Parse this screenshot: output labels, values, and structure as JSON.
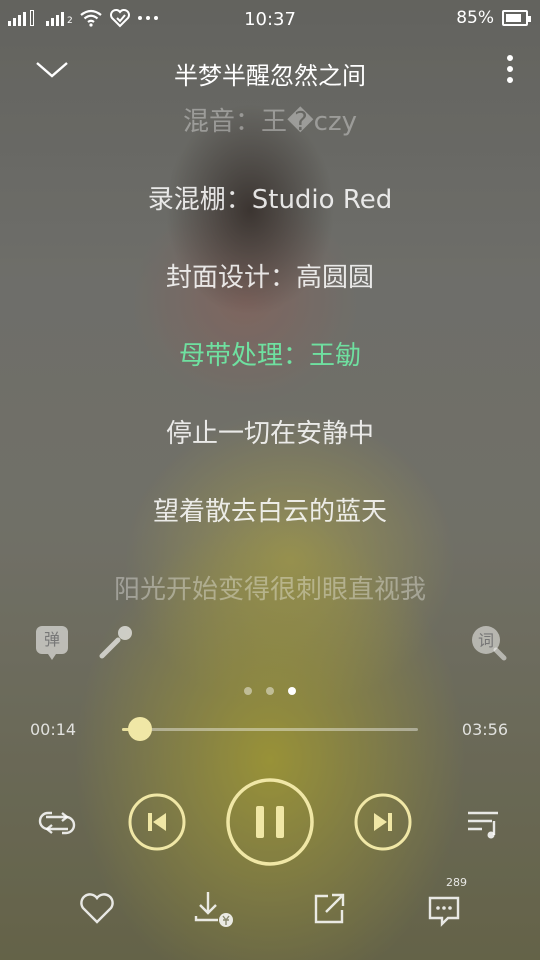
{
  "status_bar": {
    "time": "10:37",
    "battery_text": "85%",
    "battery_level": 0.85,
    "sim2_tag": "2",
    "icons": [
      "signal-icon",
      "signal-icon",
      "wifi-icon",
      "heart-shield-icon",
      "more-dots-icon",
      "battery-icon"
    ]
  },
  "header": {
    "title": "半梦半醒忽然之间",
    "back_icon": "chevron-down-icon",
    "more_icon": "vertical-dots-icon"
  },
  "lyrics": [
    {
      "text": "混音：王�czy",
      "state": "faded"
    },
    {
      "text": "录混棚：Studio Red",
      "state": "normal"
    },
    {
      "text": "封面设计：高圆圆",
      "state": "normal"
    },
    {
      "text": "母带处理：王勄",
      "state": "active"
    },
    {
      "text": "停止一切在安静中",
      "state": "normal"
    },
    {
      "text": "望着散去白云的蓝天",
      "state": "normal"
    },
    {
      "text": "阳光开始变得很刺眼直视我",
      "state": "faded"
    }
  ],
  "tools": {
    "danmu_label": "弹",
    "mic_icon": "microphone-icon",
    "lyric_search_label": "词"
  },
  "pager": {
    "count": 3,
    "active_index": 2
  },
  "playback": {
    "current_time": "00:14",
    "total_time": "03:56",
    "progress_fraction": 0.06
  },
  "controls": {
    "repeat_icon": "repeat-icon",
    "prev_icon": "skip-previous-icon",
    "play_state_icon": "pause-icon",
    "next_icon": "skip-next-icon",
    "playlist_icon": "playlist-icon"
  },
  "actions": {
    "like_icon": "heart-icon",
    "download_icon": "download-icon",
    "share_icon": "share-icon",
    "comment_icon": "comment-icon",
    "comment_count": "289"
  },
  "colors": {
    "accent_active_lyric": "#6fe0a0",
    "control_gold": "#f0e7a6"
  }
}
